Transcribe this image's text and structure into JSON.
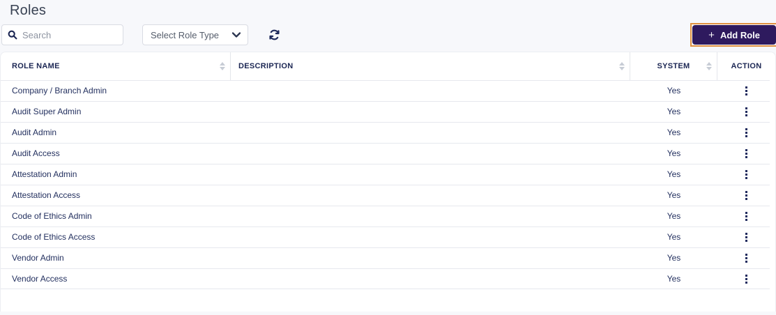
{
  "page": {
    "title": "Roles"
  },
  "toolbar": {
    "search": {
      "placeholder": "Search",
      "value": ""
    },
    "role_type_select": {
      "selected": "Select Role Type"
    },
    "add_role": {
      "plus": "+",
      "label": "Add Role"
    }
  },
  "icons": {
    "search": "magnifying-glass",
    "select_chevron": "chevron-down",
    "refresh": "circular-sync-arrows",
    "sort": "up-down-sort-arrows",
    "row_action": "vertical-ellipsis-kebab"
  },
  "colors": {
    "accent_purple": "#2e1a5e",
    "highlight_orange": "#e0913f",
    "heading_text": "#394253",
    "table_text": "#23305f"
  },
  "table": {
    "columns": [
      {
        "label": "ROLE NAME",
        "sortable": true
      },
      {
        "label": "DESCRIPTION",
        "sortable": true
      },
      {
        "label": "SYSTEM",
        "sortable": true
      },
      {
        "label": "ACTION",
        "sortable": false
      }
    ],
    "rows": [
      {
        "name": "Company / Branch Admin",
        "description": "",
        "system": "Yes"
      },
      {
        "name": "Audit Super Admin",
        "description": "",
        "system": "Yes"
      },
      {
        "name": "Audit Admin",
        "description": "",
        "system": "Yes"
      },
      {
        "name": "Audit Access",
        "description": "",
        "system": "Yes"
      },
      {
        "name": "Attestation Admin",
        "description": "",
        "system": "Yes"
      },
      {
        "name": "Attestation Access",
        "description": "",
        "system": "Yes"
      },
      {
        "name": "Code of Ethics Admin",
        "description": "",
        "system": "Yes"
      },
      {
        "name": "Code of Ethics Access",
        "description": "",
        "system": "Yes"
      },
      {
        "name": "Vendor Admin",
        "description": "",
        "system": "Yes"
      },
      {
        "name": "Vendor Access",
        "description": "",
        "system": "Yes"
      }
    ]
  }
}
